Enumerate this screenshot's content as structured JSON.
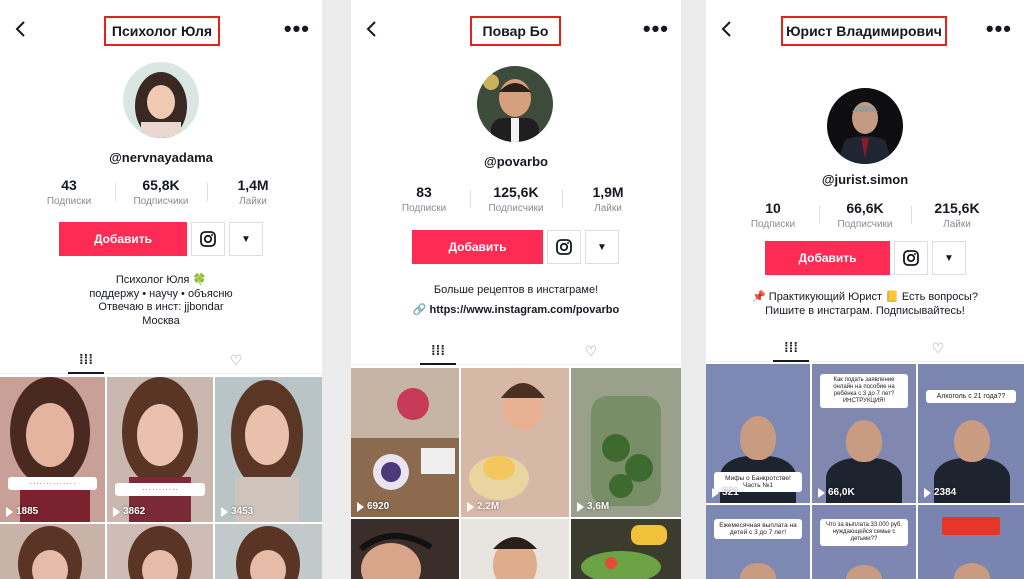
{
  "panels": [
    {
      "title": "Психолог Юля",
      "handle": "@nervnayadama",
      "stats": [
        {
          "value": "43",
          "label": "Подписки"
        },
        {
          "value": "65,8K",
          "label": "Подписчики"
        },
        {
          "value": "1,4M",
          "label": "Лайки"
        }
      ],
      "add_label": "Добавить",
      "bio": [
        "Психолог Юля 🍀",
        "поддержу • научу • объясню",
        "Отвечаю в инст: jjbondar",
        "Москва"
      ],
      "views": [
        "1885",
        "3862",
        "3453"
      ]
    },
    {
      "title": "Повар Бо",
      "handle": "@povarbo",
      "stats": [
        {
          "value": "83",
          "label": "Подписки"
        },
        {
          "value": "125,6K",
          "label": "Подписчики"
        },
        {
          "value": "1,9M",
          "label": "Лайки"
        }
      ],
      "add_label": "Добавить",
      "bio": [
        "Больше рецептов в инстаграме!"
      ],
      "link": "https://www.instagram.com/povarbo",
      "views": [
        "6920",
        "2,2M",
        "3,6M"
      ]
    },
    {
      "title": "Юрист Владимирович",
      "handle": "@jurist.simon",
      "stats": [
        {
          "value": "10",
          "label": "Подписки"
        },
        {
          "value": "66,6K",
          "label": "Подписчики"
        },
        {
          "value": "215,6K",
          "label": "Лайки"
        }
      ],
      "add_label": "Добавить",
      "bio": [
        "📌 Практикующий Юрист 📒 Есть вопросы?",
        "Пишите в инстаграм. Подписывайтесь!"
      ],
      "views": [
        "521",
        "66,0K",
        "2384"
      ],
      "stickers": [
        "Мифы о Банкротстве! Часть №1",
        "Как подать заявление онлайн на пособие на ребёнка с 3 до 7 лет? ИНСТРУКЦИЯ!",
        "Алкоголь с 21 года??",
        "Ежемесячная выплата на детей с 3 до 7 лет!",
        "Что за выплата 33.000 руб. нуждающейся семье с детьми??"
      ]
    }
  ],
  "colors": {
    "accent": "#fe2c55",
    "highlight_box": "#e2231a"
  }
}
